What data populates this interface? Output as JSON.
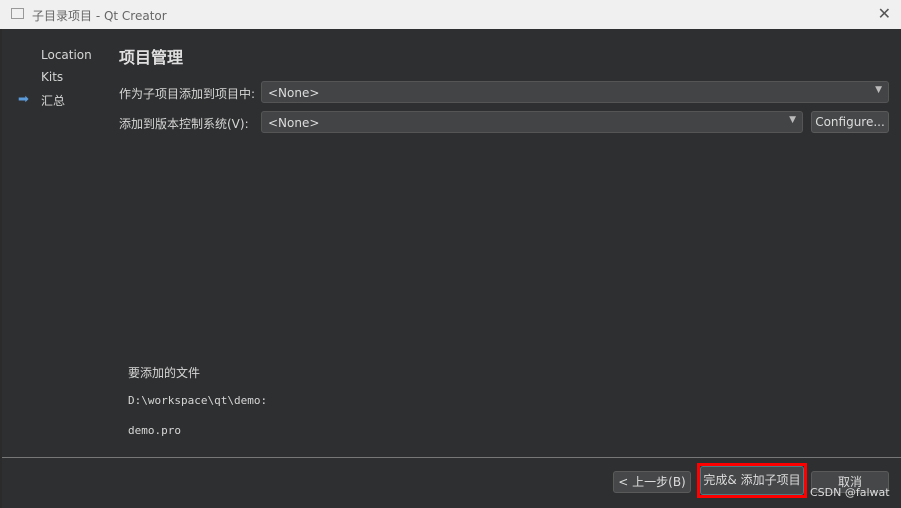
{
  "window": {
    "title": "子目录项目 - Qt Creator",
    "close_icon": "close-icon"
  },
  "sidebar": {
    "items": [
      {
        "label": "Location"
      },
      {
        "label": "Kits"
      },
      {
        "label": "汇总",
        "current": true
      }
    ]
  },
  "page": {
    "title": "项目管理",
    "add_as_subproject_label": "作为子项目添加到项目中:",
    "add_as_subproject_value": "<None>",
    "vcs_label": "添加到版本控制系统(V):",
    "vcs_value": "<None>",
    "configure_label": "Configure...",
    "files_label": "要添加的文件",
    "files_path": "D:\\workspace\\qt\\demo:",
    "files": [
      "demo.pro"
    ]
  },
  "buttons": {
    "back": "< 上一步(B)",
    "finish": "完成& 添加子项目",
    "cancel": "取消"
  },
  "watermark": "CSDN @falwat",
  "colors": {
    "highlight": "#ff0000",
    "accent": "#5a9bdc"
  }
}
